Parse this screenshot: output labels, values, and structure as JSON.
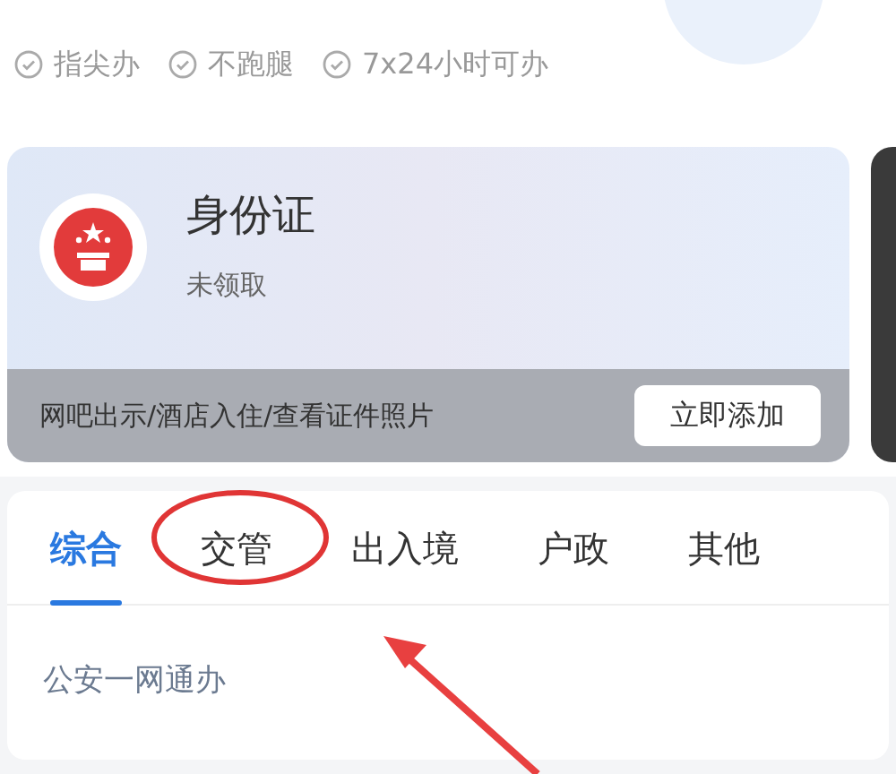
{
  "features": [
    "指尖办",
    "不跑腿",
    "7x24小时可办"
  ],
  "id_card": {
    "title": "身份证",
    "status": "未领取",
    "hint": "网吧出示/酒店入住/查看证件照片",
    "button": "立即添加"
  },
  "tabs": [
    {
      "label": "综合",
      "selected": true
    },
    {
      "label": "交管",
      "selected": false
    },
    {
      "label": "出入境",
      "selected": false
    },
    {
      "label": "户政",
      "selected": false
    },
    {
      "label": "其他",
      "selected": false
    }
  ],
  "section_title": "公安一网通办"
}
